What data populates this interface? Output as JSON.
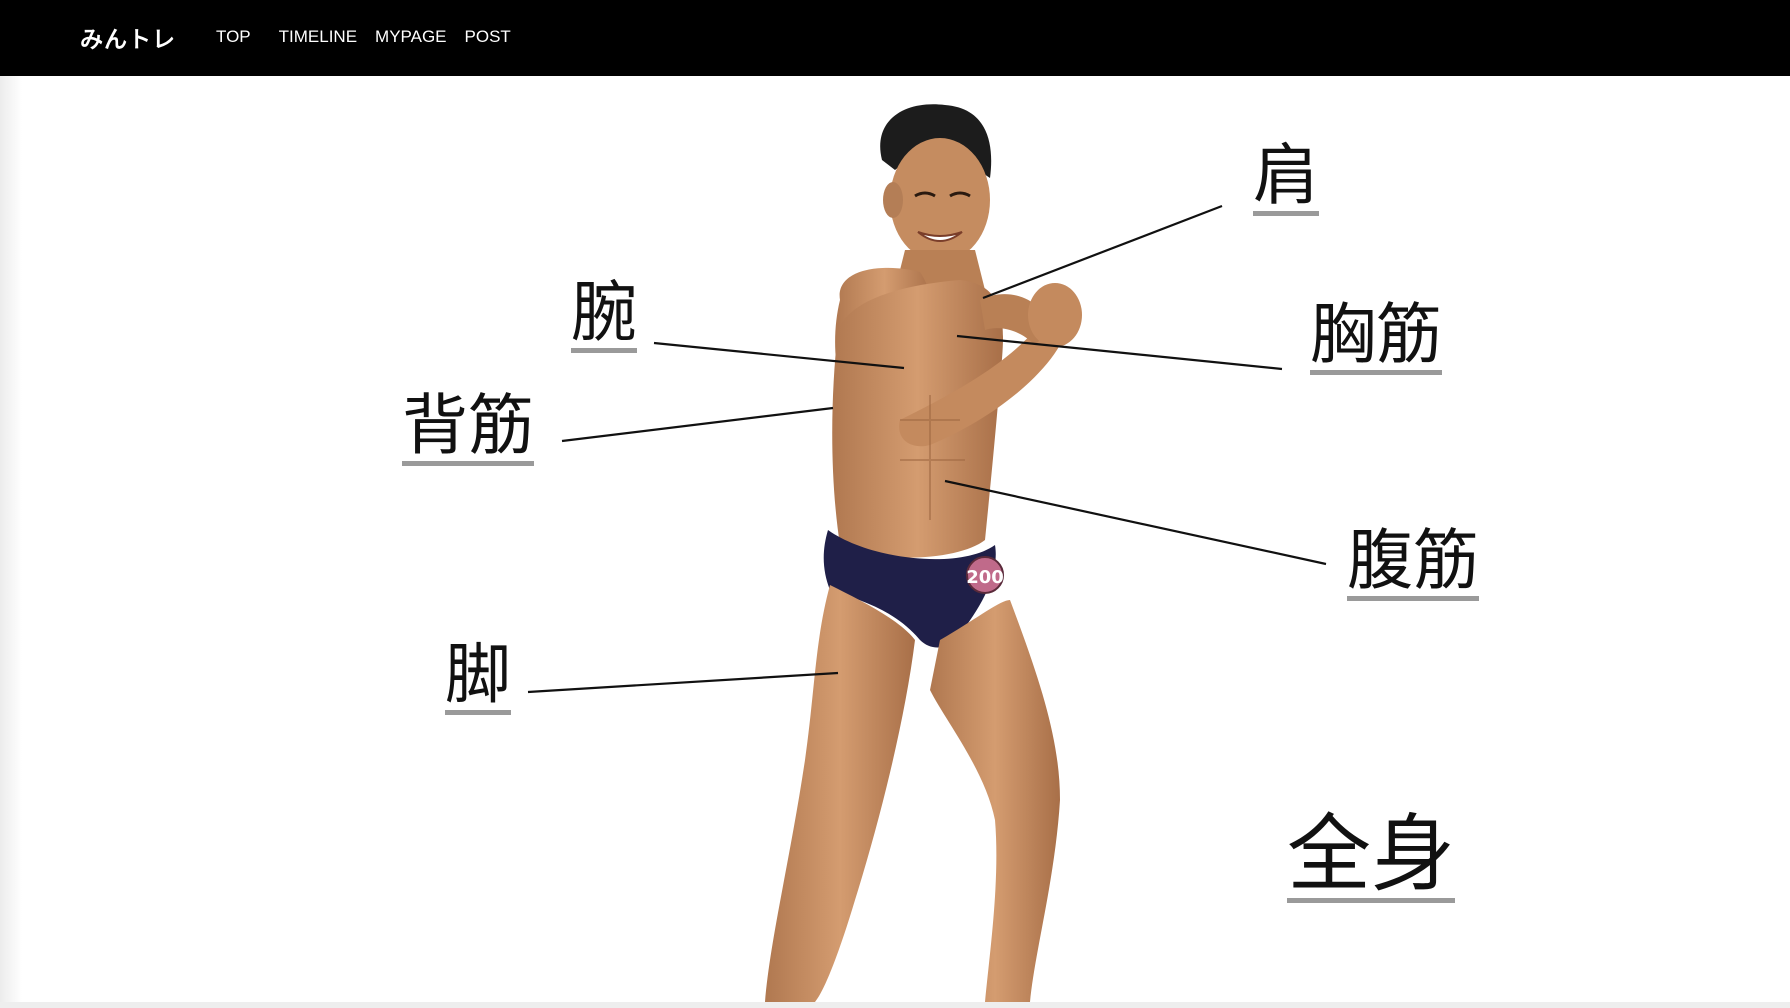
{
  "nav": {
    "brand": "みんトレ",
    "links": [
      "TOP",
      "TIMELINE",
      "MYPAGE",
      "POST"
    ]
  },
  "figure": {
    "bib_number": "200",
    "labels": {
      "shoulder": "肩",
      "arm": "腕",
      "chest": "胸筋",
      "back": "背筋",
      "abs": "腹筋",
      "legs": "脚",
      "full_body": "全身"
    }
  },
  "colors": {
    "navbar": "#000000",
    "label_underline": "#9a9a9a",
    "skin": "#c98f63",
    "trunks": "#1f1f48",
    "bib": "#c06a8a"
  }
}
